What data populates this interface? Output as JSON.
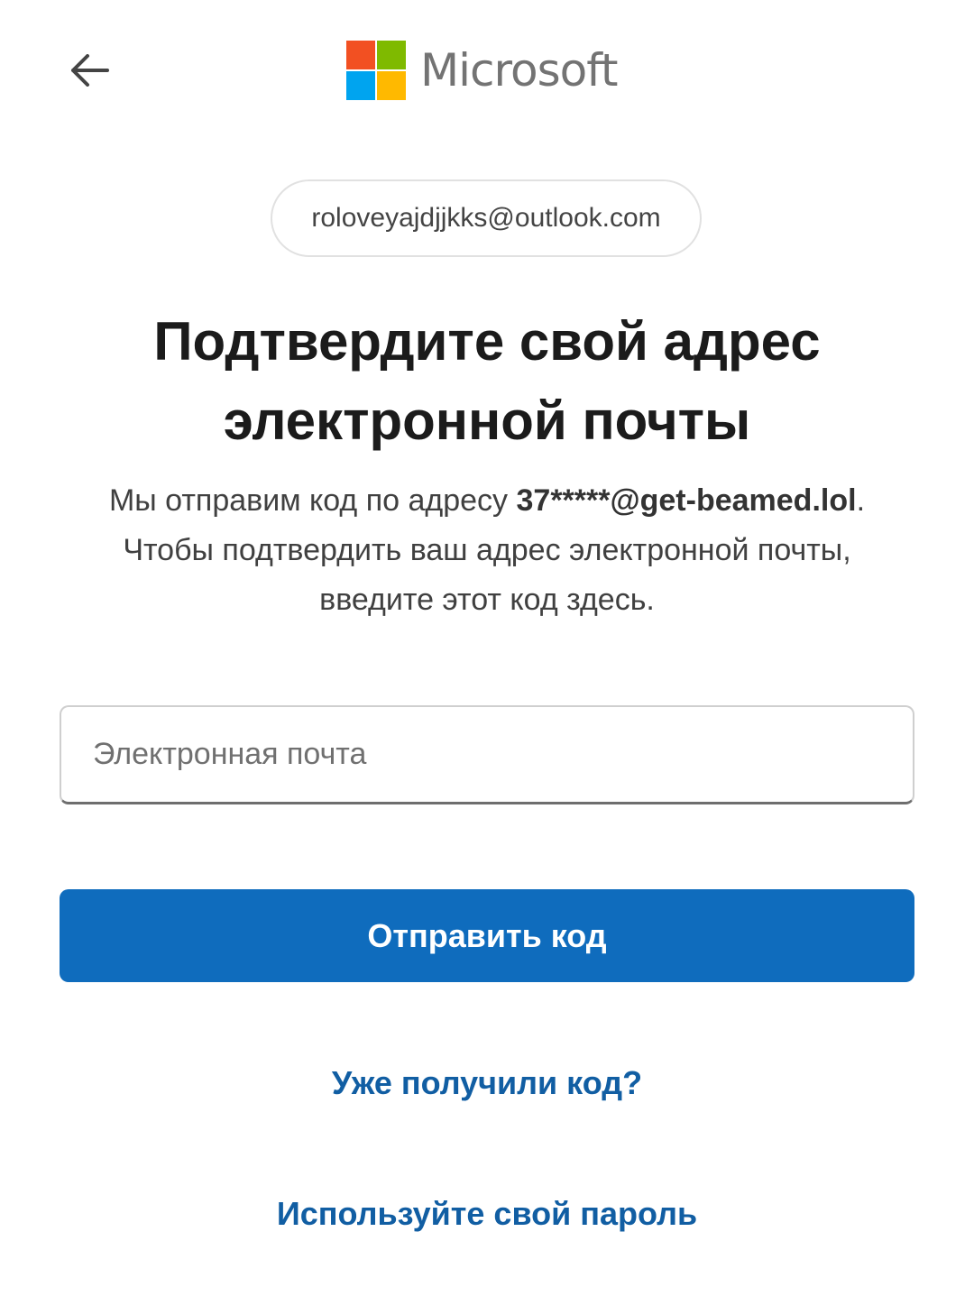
{
  "header": {
    "back_icon": "arrow-left-icon",
    "logo_text": "Microsoft",
    "logo_colors": [
      "#f25022",
      "#7fba00",
      "#00a4ef",
      "#ffb900"
    ]
  },
  "account": {
    "email": "roloveyajdjjkks@outlook.com"
  },
  "title": {
    "line1": "Подтвердите свой адрес",
    "line2": "электронной почты"
  },
  "description": {
    "prefix": "Мы отправим код по адресу ",
    "masked_email": "37*****@get-beamed.lol",
    "suffix": ". Чтобы подтвердить ваш адрес электронной почты, введите этот код здесь."
  },
  "email_field": {
    "placeholder": "Электронная почта",
    "value": ""
  },
  "send_button": {
    "label": "Отправить код",
    "color": "#0f6cbd"
  },
  "links": {
    "have_code": "Уже получили код?",
    "use_password": "Используйте свой пароль",
    "color": "#115ea3"
  }
}
